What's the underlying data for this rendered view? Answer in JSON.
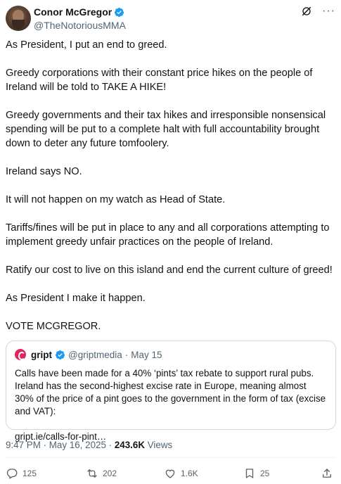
{
  "author": {
    "name": "Conor McGregor",
    "handle": "@TheNotoriousMMA"
  },
  "icons": {
    "verified": "verified-badge-icon",
    "grok": "grok-icon",
    "more": "more-icon"
  },
  "tweet": {
    "paragraphs": [
      "As President, I put an end to greed.",
      "Greedy corporations with their constant price hikes on the people of Ireland will be told to TAKE A HIKE!",
      "Greedy governments and their tax hikes and irresponsible nonsensical spending will be put to a complete halt with full accountability brought down to deter any future tomfoolery.",
      "Ireland says NO.",
      "It will not happen on my watch as Head of State.",
      "Tariffs/fines will be put in place to any and all corporations attempting to implement greedy unfair practices on the people of Ireland.",
      "Ratify our cost to live on this island and end the current culture of greed!",
      "As President I make it happen.",
      "VOTE MCGREGOR."
    ]
  },
  "quote": {
    "name": "gript",
    "handle": "@griptmedia",
    "separator": "·",
    "date": "May 15",
    "text": "Calls have been made for a 40% ‘pints’ tax rebate to support rural pubs. Ireland has the second-highest excise rate in Europe, meaning almost 30% of the price of a pint goes to the government in the form of tax (excise and VAT):",
    "link": "gript.ie/calls-for-pint…"
  },
  "meta": {
    "timestamp": "9:47 PM · May 16, 2025 · ",
    "views_count": "243.6K",
    "views_label": " Views"
  },
  "actions": {
    "replies": "125",
    "reposts": "202",
    "likes": "1.6K",
    "bookmarks": "25"
  },
  "colors": {
    "verified": "#1d9bf0",
    "text": "#0f1419",
    "secondary": "#536471",
    "border": "#cfd9de",
    "gript": "#e0245e"
  }
}
